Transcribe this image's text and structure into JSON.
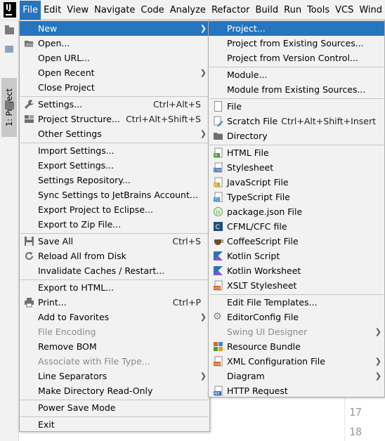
{
  "menubar": {
    "items": [
      "File",
      "Edit",
      "View",
      "Navigate",
      "Code",
      "Analyze",
      "Refactor",
      "Build",
      "Run",
      "Tools",
      "VCS",
      "Wind"
    ],
    "active": "File"
  },
  "toolwindow": {
    "project_tab": "1: Project"
  },
  "editor": {
    "line_numbers": [
      "17",
      "18"
    ]
  },
  "file_menu": {
    "items": [
      {
        "label": "New",
        "arrow": true,
        "highlighted": true
      },
      {
        "label": "Open...",
        "icon": "folder-open-icon"
      },
      {
        "label": "Open URL..."
      },
      {
        "label": "Open Recent",
        "arrow": true
      },
      {
        "label": "Close Project"
      },
      {
        "label": "Settings...",
        "shortcut": "Ctrl+Alt+S",
        "icon": "wrench-icon"
      },
      {
        "label": "Project Structure...",
        "shortcut": "Ctrl+Alt+Shift+S",
        "icon": "project-structure-icon"
      },
      {
        "label": "Other Settings",
        "arrow": true
      },
      {
        "label": "Import Settings..."
      },
      {
        "label": "Export Settings..."
      },
      {
        "label": "Settings Repository..."
      },
      {
        "label": "Sync Settings to JetBrains Account..."
      },
      {
        "label": "Export Project to Eclipse..."
      },
      {
        "label": "Export to Zip File..."
      },
      {
        "label": "Save All",
        "shortcut": "Ctrl+S",
        "icon": "save-icon"
      },
      {
        "label": "Reload All from Disk",
        "icon": "reload-icon"
      },
      {
        "label": "Invalidate Caches / Restart..."
      },
      {
        "label": "Export to HTML..."
      },
      {
        "label": "Print...",
        "shortcut": "Ctrl+P",
        "icon": "print-icon"
      },
      {
        "label": "Add to Favorites",
        "arrow": true
      },
      {
        "label": "File Encoding",
        "disabled": true
      },
      {
        "label": "Remove BOM"
      },
      {
        "label": "Associate with File Type...",
        "disabled": true
      },
      {
        "label": "Line Separators",
        "arrow": true
      },
      {
        "label": "Make Directory Read-Only"
      },
      {
        "label": "Power Save Mode"
      },
      {
        "label": "Exit"
      }
    ]
  },
  "new_menu": {
    "items": [
      {
        "label": "Project...",
        "highlighted": true
      },
      {
        "label": "Project from Existing Sources..."
      },
      {
        "label": "Project from Version Control..."
      },
      {
        "label": "Module..."
      },
      {
        "label": "Module from Existing Sources..."
      },
      {
        "label": "File",
        "icon": "file-icon"
      },
      {
        "label": "Scratch File",
        "shortcut": "Ctrl+Alt+Shift+Insert",
        "icon": "scratch-file-icon"
      },
      {
        "label": "Directory",
        "icon": "directory-icon"
      },
      {
        "label": "HTML File",
        "icon": "html-file-icon"
      },
      {
        "label": "Stylesheet",
        "icon": "css-file-icon"
      },
      {
        "label": "JavaScript File",
        "icon": "js-file-icon"
      },
      {
        "label": "TypeScript File",
        "icon": "ts-file-icon"
      },
      {
        "label": "package.json File",
        "icon": "package-json-icon"
      },
      {
        "label": "CFML/CFC file",
        "icon": "cfml-file-icon"
      },
      {
        "label": "CoffeeScript File",
        "icon": "coffeescript-file-icon"
      },
      {
        "label": "Kotlin Script",
        "icon": "kotlin-script-icon"
      },
      {
        "label": "Kotlin Worksheet",
        "icon": "kotlin-worksheet-icon"
      },
      {
        "label": "XSLT Stylesheet",
        "icon": "xslt-file-icon"
      },
      {
        "label": "Edit File Templates..."
      },
      {
        "label": "EditorConfig File",
        "icon": "editorconfig-icon"
      },
      {
        "label": "Swing UI Designer",
        "arrow": true,
        "disabled": true
      },
      {
        "label": "Resource Bundle",
        "icon": "resource-bundle-icon"
      },
      {
        "label": "XML Configuration File",
        "arrow": true,
        "icon": "xml-file-icon"
      },
      {
        "label": "Diagram",
        "arrow": true
      },
      {
        "label": "HTTP Request",
        "icon": "http-request-icon"
      }
    ]
  },
  "colors": {
    "highlight": "#2675bf",
    "menu_bg": "#f2f2f2",
    "menubar_bg": "#f2f2f2"
  }
}
